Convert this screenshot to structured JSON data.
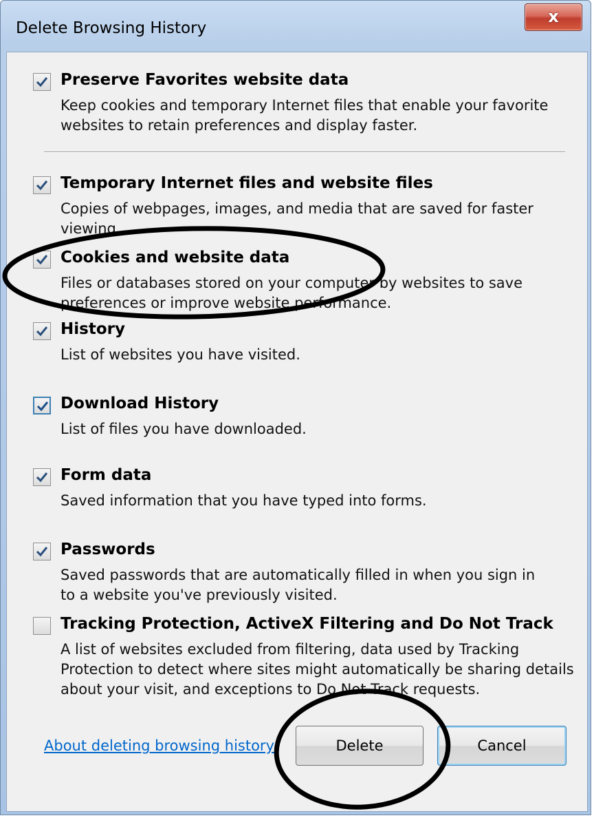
{
  "window": {
    "title": "Delete Browsing History",
    "close_icon": "close-icon",
    "close_glyph": "x"
  },
  "options": [
    {
      "label": "Preserve Favorites website data",
      "description": "Keep cookies and temporary Internet files that enable your favorite websites to retain preferences and display faster.",
      "checked": true
    },
    {
      "label": "Temporary Internet files and website files",
      "description": "Copies of webpages, images, and media that are saved for faster viewing.",
      "checked": true
    },
    {
      "label": "Cookies and website data",
      "description": "Files or databases stored on your computer by websites to save preferences or improve website performance.",
      "checked": true
    },
    {
      "label": "History",
      "description": "List of websites you have visited.",
      "checked": true
    },
    {
      "label": "Download History",
      "description": "List of files you have downloaded.",
      "checked": true
    },
    {
      "label": "Form data",
      "description": "Saved information that you have typed into forms.",
      "checked": true
    },
    {
      "label": "Passwords",
      "description": "Saved passwords that are automatically filled in when you sign in to a website you've previously visited.",
      "checked": true
    },
    {
      "label": "Tracking Protection, ActiveX Filtering and Do Not Track",
      "description": "A list of websites excluded from filtering, data used by Tracking Protection to detect where sites might automatically be sharing details about your visit, and exceptions to Do Not Track requests.",
      "checked": false
    }
  ],
  "footer": {
    "help_link": "About deleting browsing history",
    "delete_label": "Delete",
    "cancel_label": "Cancel"
  },
  "colors": {
    "link": "#0066cc",
    "annotation": "#000000"
  }
}
